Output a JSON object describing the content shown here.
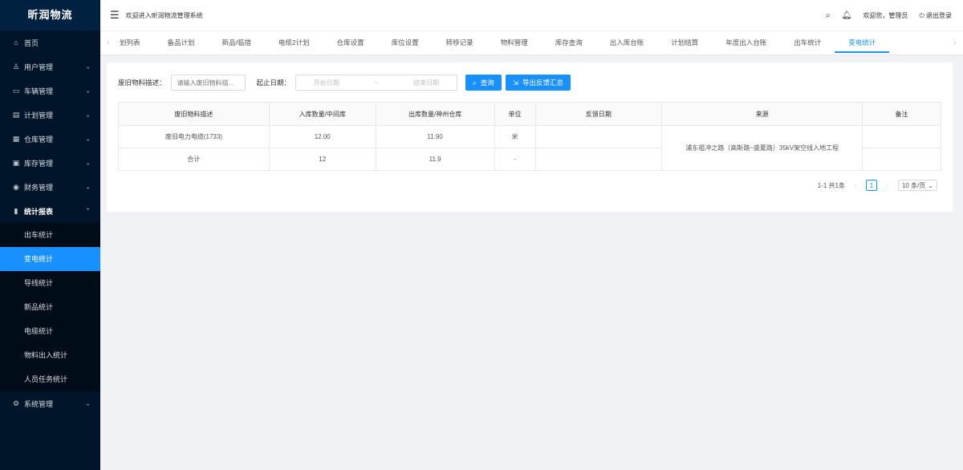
{
  "app": {
    "name": "昕润物流",
    "welcome": "欢迎进入昕润物流管理系统",
    "greeting": "欢迎您，管理员",
    "logout": "退出登录"
  },
  "sidebar": {
    "items": [
      {
        "label": "首页",
        "icon": "home-icon"
      },
      {
        "label": "用户管理",
        "icon": "user-icon"
      },
      {
        "label": "车辆管理",
        "icon": "car-icon"
      },
      {
        "label": "计划管理",
        "icon": "file-icon"
      },
      {
        "label": "仓库管理",
        "icon": "warehouse-icon"
      },
      {
        "label": "库存管理",
        "icon": "inventory-icon"
      },
      {
        "label": "财务管理",
        "icon": "finance-icon"
      },
      {
        "label": "统计报表",
        "icon": "chart-icon"
      }
    ],
    "stats_sub": [
      "出车统计",
      "变电统计",
      "导线统计",
      "新品统计",
      "电缆统计",
      "物料出入统计",
      "人员任务统计"
    ],
    "settings": "系统管理"
  },
  "tabs": [
    "划列表",
    "备品计划",
    "新品/临措",
    "电缆2计划",
    "仓库设置",
    "库位设置",
    "转移记录",
    "物料管理",
    "库存查询",
    "出入库台账",
    "计划结算",
    "年度出入台账",
    "出车统计",
    "变电统计"
  ],
  "search": {
    "desc_label": "废旧物料描述：",
    "desc_placeholder": "请输入废旧物料描...",
    "date_label": "起止日期：",
    "start_placeholder": "开始日期",
    "separator": "~",
    "end_placeholder": "结束日期",
    "query_btn": "查询",
    "export_btn": "导出反馈汇总"
  },
  "table": {
    "headers": [
      "废旧物料描述",
      "入库数量/中间库",
      "出库数量/神州仓库",
      "单位",
      "反馈日期",
      "来源",
      "备注"
    ],
    "rows": [
      [
        "废旧电力电缆(1733)",
        "12.00",
        "11.90",
        "米",
        "",
        "",
        ""
      ],
      [
        "合计",
        "12",
        "11.9",
        "-",
        "",
        "",
        ""
      ]
    ],
    "source_merged": "浦东祖冲之路（高斯路~盛夏路）35kV架空线入地工程"
  },
  "pagination": {
    "summary": "1-1 共1条",
    "current": "1",
    "page_size": "10 条/页"
  }
}
